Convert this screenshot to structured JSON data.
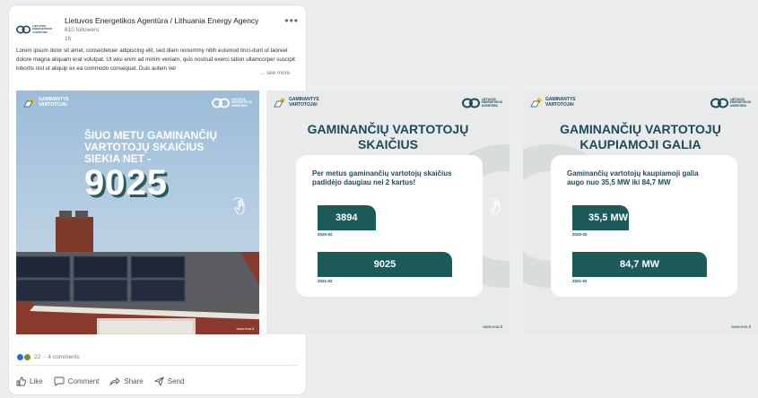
{
  "post": {
    "company_name": "Lietuvos Energetikos Agentūra / Lithuania Energy Agency",
    "followers": "610 followers",
    "time": "1h",
    "more_label": "•••",
    "body_text": "Lorem ipsum dolor sit amet, consectetuer adipiscing elit, sed diam nonummy nibh euismod tinci-dunt ut laoreet dolore magna aliquam erat volutpat. Ut wisi enim ad minim veniam, quis nostrud exerci tation ullamcorper suscipit lobortis nisl ut aliquip ex ea commodo consequat. Duis autem vel",
    "see_more": "... see more",
    "reactions_count": "22",
    "reactions_sep": "·",
    "comments_count": "4 comments"
  },
  "actions": {
    "like": "Like",
    "comment": "Comment",
    "share": "Share",
    "send": "Send"
  },
  "brand": {
    "gaminantys_line1": "GAMINANTYS",
    "gaminantys_line2": "VARTOTOJAI",
    "lea_line1": "LIETUVOS",
    "lea_line2": "ENERGETIKOS",
    "lea_line3": "AGENTŪRA"
  },
  "slide1": {
    "heading_line1": "ŠIUO METU GAMINANČIŲ",
    "heading_line2": "VARTOTOJŲ SKAIČIUS",
    "heading_line3": "SIEKIA NET -",
    "big_number": "9025",
    "url": "www.ena.lt"
  },
  "slide2": {
    "title_line1": "GAMINANČIŲ VARTOTOJŲ",
    "title_line2": "SKAIČIUS",
    "panel_line1": "Per metus gaminančių vartotojų skaičius",
    "panel_line2": "padidėjo daugiau nei 2 kartus!",
    "url": "www.ena.lt"
  },
  "slide3": {
    "title_line1": "GAMINANČIŲ VARTOTOJŲ",
    "title_line2": "KAUPIAMOJI GALIA",
    "panel_line1": "Gaminančių vartotojų kaupiamoji galia",
    "panel_line2": "augo nuo 35,5 MW iki 84,7 MW",
    "url": "www.ena.lt"
  },
  "chart_data": [
    {
      "type": "bar",
      "categories": [
        "2020-02",
        "2021-02"
      ],
      "values": [
        3894,
        9025
      ],
      "value_labels": [
        "3894",
        "9025"
      ],
      "title": "GAMINANČIŲ VARTOTOJŲ SKAIČIUS",
      "xlabel": "",
      "ylabel": ""
    },
    {
      "type": "bar",
      "categories": [
        "2020-02",
        "2021-02"
      ],
      "values": [
        35.5,
        84.7
      ],
      "value_labels": [
        "35,5 MW",
        "84,7 MW"
      ],
      "title": "GAMINANČIŲ VARTOTOJŲ KAUPIAMOJI GALIA",
      "xlabel": "",
      "ylabel": ""
    }
  ],
  "colors": {
    "brand_teal": "#1d5a5a",
    "brand_dark": "#1d4a5a",
    "sun_yellow": "#f2b51c",
    "slide_bg": "#e9eaea"
  }
}
